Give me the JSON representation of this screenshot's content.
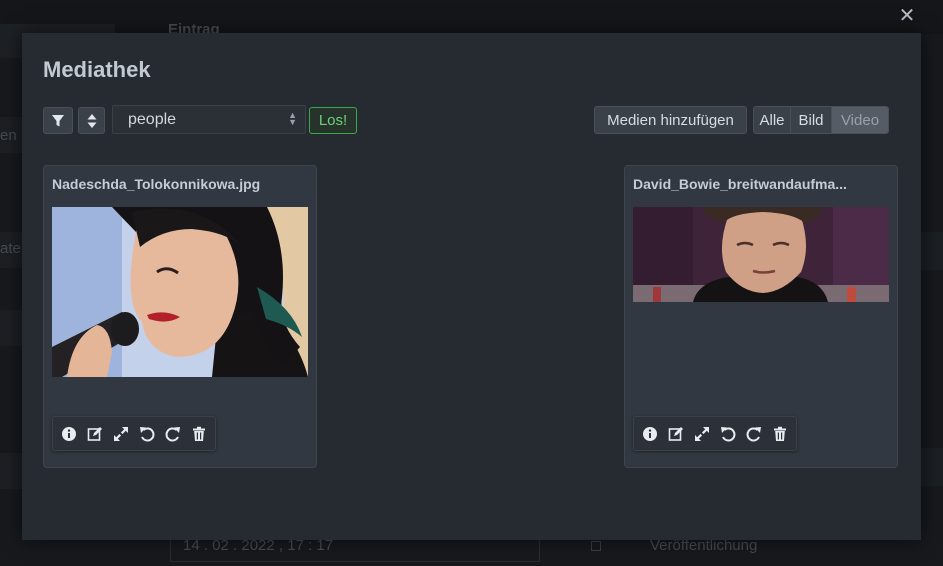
{
  "background": {
    "header_text": "Eintrag",
    "side_text_1": "en",
    "side_text_2": "ate",
    "bottom_date": "14 . 02 . 2022 , 17 : 17",
    "bottom_label": "Veröffentlichung"
  },
  "modal": {
    "title": "Mediathek",
    "close_icon": "close-icon",
    "toolbar": {
      "filter_icon": "filter-icon",
      "sort_icon": "sort-icon",
      "search_value": "people",
      "go_label": "Los!",
      "add_label": "Medien hinzufügen",
      "type_filters": [
        "Alle",
        "Bild",
        "Video"
      ],
      "active_type": "Video"
    },
    "media": [
      {
        "filename": "Nadeschda_Tolokonnikowa.jpg",
        "image": "woman-singing-into-microphone",
        "actions": [
          "info-icon",
          "edit-icon",
          "resize-icon",
          "rotate-left-icon",
          "rotate-right-icon",
          "trash-icon"
        ]
      },
      {
        "filename": "David_Bowie_breitwandaufma...",
        "image": "portrait-man-purple-background",
        "actions": [
          "info-icon",
          "edit-icon",
          "resize-icon",
          "rotate-left-icon",
          "rotate-right-icon",
          "trash-icon"
        ]
      }
    ]
  },
  "colors": {
    "modal_bg": "#262b32",
    "card_bg": "#323841",
    "go_button": "#3fa74b"
  }
}
